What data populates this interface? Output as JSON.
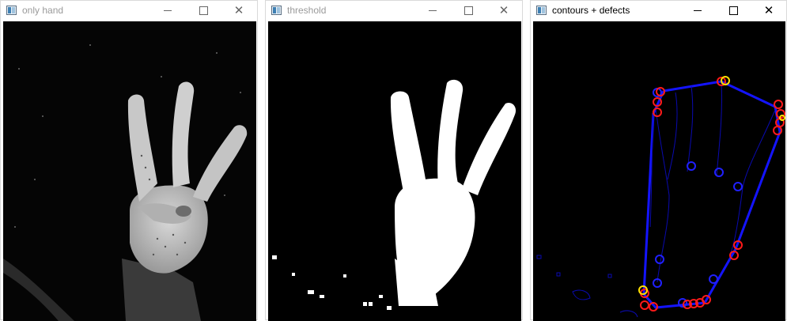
{
  "windows": [
    {
      "title": "only hand"
    },
    {
      "title": "threshold"
    },
    {
      "title": "contours + defects"
    }
  ],
  "controls": {
    "minimize": "—",
    "maximize": "☐",
    "close": "✕"
  },
  "icons": [
    "window-app-icon",
    "minimize-icon",
    "maximize-icon",
    "close-icon",
    "hand-image",
    "threshold-image",
    "contours-image"
  ],
  "colors": {
    "hull_line": "#0000ff",
    "contour_line": "#0000c0",
    "defect_circle": "#0000ff",
    "start_end_circle": "#ff0000",
    "far_point_circle": "#ffff00"
  }
}
